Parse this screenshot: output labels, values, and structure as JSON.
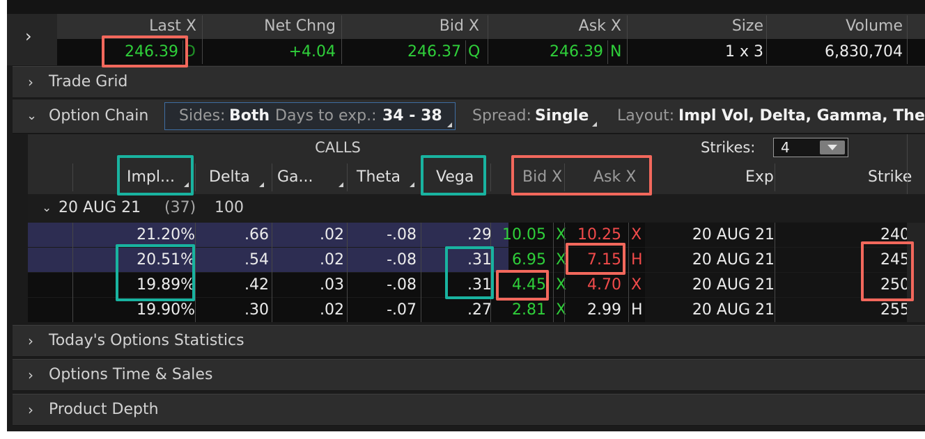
{
  "quote": {
    "headers": {
      "last": "Last X",
      "net": "Net Chng",
      "bid": "Bid X",
      "ask": "Ask X",
      "size": "Size",
      "volume": "Volume"
    },
    "values": {
      "last": "246.39",
      "last_exch": "D",
      "net": "+4.04",
      "bid": "246.37",
      "bid_exch": "Q",
      "ask": "246.39",
      "ask_exch": "N",
      "size": "1 x 3",
      "volume": "6,830,704"
    }
  },
  "sections": {
    "trade_grid": "Trade Grid",
    "option_chain": "Option Chain",
    "stats": "Today's Options Statistics",
    "time_sales": "Options Time & Sales",
    "depth": "Product Depth"
  },
  "chain_toolbar": {
    "sides_label": "Sides:",
    "sides_value": "Both",
    "days_label": "Days to exp.:",
    "days_value": "34 - 38",
    "spread_label": "Spread:",
    "spread_value": "Single",
    "layout_label": "Layout:",
    "layout_value": "Impl Vol, Delta, Gamma, Thet"
  },
  "chain_header": {
    "calls": "CALLS",
    "strikes_label": "Strikes:",
    "strikes_value": "4",
    "columns": {
      "impl": "Impl...",
      "delta": "Delta",
      "gamma": "Ga...",
      "theta": "Theta",
      "vega": "Vega",
      "bid": "Bid X",
      "ask": "Ask X",
      "exp": "Exp",
      "strike": "Strike"
    }
  },
  "expiry_group": {
    "date": "20 AUG 21",
    "days": "(37)",
    "multiplier": "100"
  },
  "rows": [
    {
      "impl": "21.20%",
      "delta": ".66",
      "gamma": ".02",
      "theta": "-.08",
      "vega": ".29",
      "bid": "10.05",
      "bid_exch": "X",
      "ask": "10.25",
      "ask_exch": "X",
      "exp": "20 AUG 21",
      "strike": "240"
    },
    {
      "impl": "20.51%",
      "delta": ".54",
      "gamma": ".02",
      "theta": "-.08",
      "vega": ".31",
      "bid": "6.95",
      "bid_exch": "X",
      "ask": "7.15",
      "ask_exch": "H",
      "exp": "20 AUG 21",
      "strike": "245"
    },
    {
      "impl": "19.89%",
      "delta": ".42",
      "gamma": ".03",
      "theta": "-.08",
      "vega": ".31",
      "bid": "4.45",
      "bid_exch": "X",
      "ask": "4.70",
      "ask_exch": "X",
      "exp": "20 AUG 21",
      "strike": "250"
    },
    {
      "impl": "19.90%",
      "delta": ".30",
      "gamma": ".02",
      "theta": "-.07",
      "vega": ".27",
      "bid": "2.81",
      "bid_exch": "X",
      "ask": "2.99",
      "ask_exch": "H",
      "exp": "20 AUG 21",
      "strike": "255"
    }
  ],
  "colors": {
    "up": "#2fcf3a",
    "down": "#f04a4a",
    "highlight_red": "#f2685c",
    "highlight_teal": "#19b3a0",
    "itm_row": "#30305a"
  }
}
